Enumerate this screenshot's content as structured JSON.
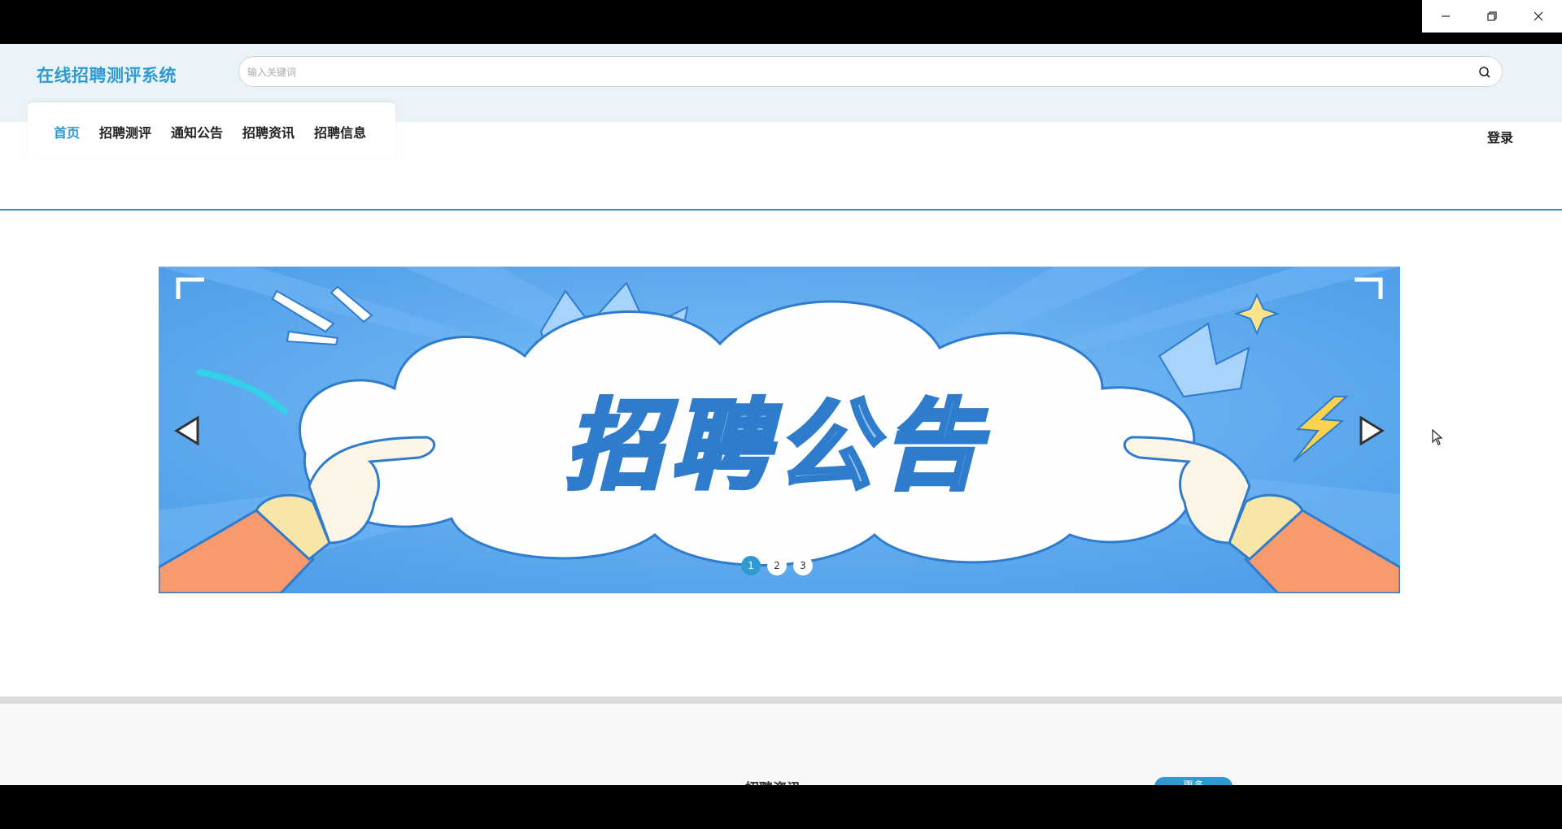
{
  "window": {
    "minimize_icon": "minimize-icon",
    "restore_icon": "restore-icon",
    "close_icon": "close-icon"
  },
  "header": {
    "site_title": "在线招聘测评系统",
    "search_placeholder": "输入关键词",
    "search_value": "",
    "search_icon": "search-icon"
  },
  "nav": {
    "items": [
      {
        "label": "首页",
        "active": true
      },
      {
        "label": "招聘测评",
        "active": false
      },
      {
        "label": "通知公告",
        "active": false
      },
      {
        "label": "招聘资讯",
        "active": false
      },
      {
        "label": "招聘信息",
        "active": false
      }
    ],
    "login_label": "登录"
  },
  "carousel": {
    "banner_text": "招聘公告",
    "dots": [
      "1",
      "2",
      "3"
    ],
    "active_dot": 0,
    "prev_icon": "triangle-left-icon",
    "next_icon": "triangle-right-icon"
  },
  "section": {
    "title": "招聘资讯",
    "tab_label": "更多"
  },
  "colors": {
    "accent": "#2e9ad0",
    "topbar_bg": "#eaf4f8",
    "banner_bg": "#5aa9ee",
    "banner_text": "#8ec6f5"
  }
}
